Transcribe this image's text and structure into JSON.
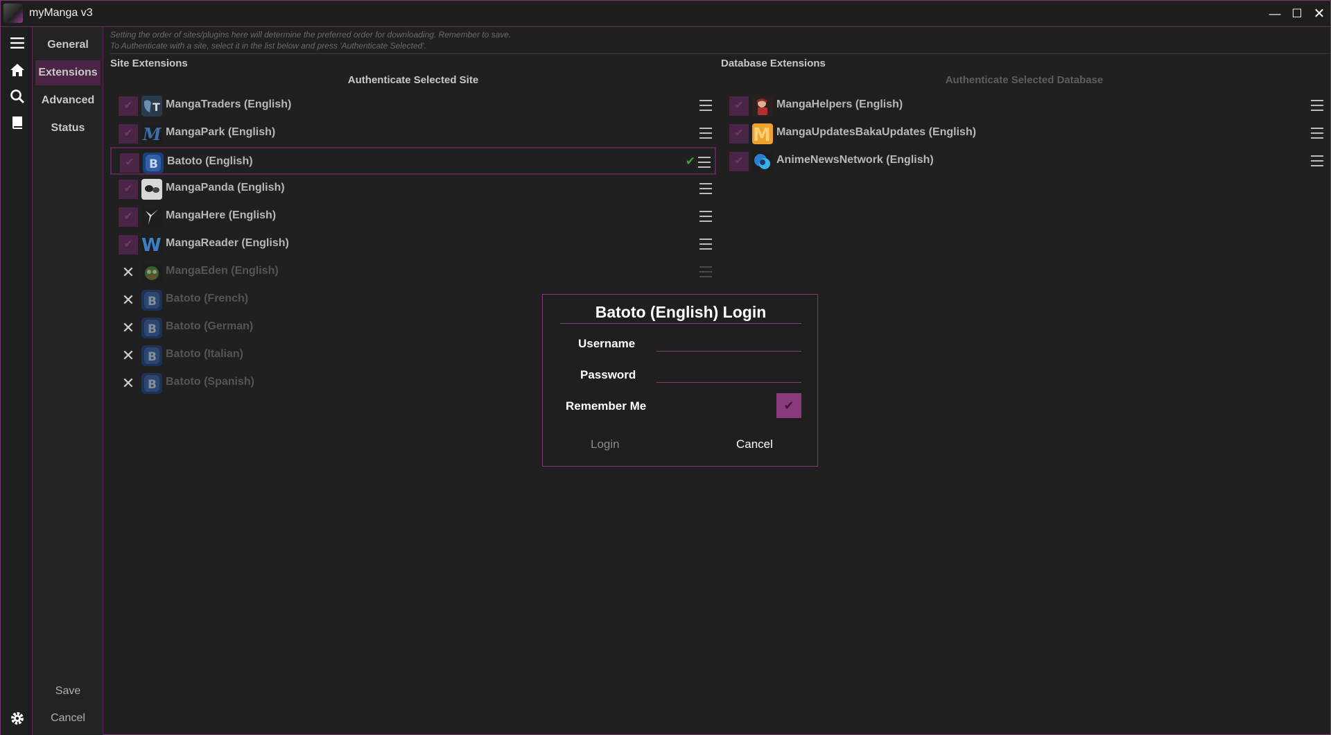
{
  "window": {
    "title": "myManga v3"
  },
  "nav": {
    "items": [
      "General",
      "Extensions",
      "Advanced",
      "Status"
    ],
    "active": "Extensions",
    "save": "Save",
    "cancel": "Cancel"
  },
  "hint": {
    "line1": "Setting the order of sites/plugins here will determine the preferred order for downloading. Remember to save.",
    "line2": "To Authenticate with a site, select it in the list below and press 'Authenticate Selected'."
  },
  "site_extensions": {
    "title": "Site Extensions",
    "authenticate_label": "Authenticate Selected Site",
    "items": [
      {
        "label": "MangaTraders (English)",
        "enabled": true,
        "icon": "mangatraders-icon"
      },
      {
        "label": "MangaPark (English)",
        "enabled": true,
        "icon": "mangapark-icon"
      },
      {
        "label": "Batoto (English)",
        "enabled": true,
        "icon": "batoto-icon",
        "selected": true,
        "authenticated": true
      },
      {
        "label": "MangaPanda (English)",
        "enabled": true,
        "icon": "mangapanda-icon"
      },
      {
        "label": "MangaHere (English)",
        "enabled": true,
        "icon": "mangahere-icon"
      },
      {
        "label": "MangaReader (English)",
        "enabled": true,
        "icon": "mangareader-icon"
      },
      {
        "label": "MangaEden (English)",
        "enabled": false,
        "icon": "mangaeden-icon"
      },
      {
        "label": "Batoto (French)",
        "enabled": false,
        "icon": "batoto-icon"
      },
      {
        "label": "Batoto (German)",
        "enabled": false,
        "icon": "batoto-icon"
      },
      {
        "label": "Batoto (Italian)",
        "enabled": false,
        "icon": "batoto-icon"
      },
      {
        "label": "Batoto (Spanish)",
        "enabled": false,
        "icon": "batoto-icon"
      }
    ]
  },
  "database_extensions": {
    "title": "Database Extensions",
    "authenticate_label": "Authenticate Selected Database",
    "items": [
      {
        "label": "MangaHelpers (English)",
        "enabled": true,
        "icon": "mangahelpers-icon"
      },
      {
        "label": "MangaUpdatesBakaUpdates (English)",
        "enabled": true,
        "icon": "mangaupdates-icon"
      },
      {
        "label": "AnimeNewsNetwork (English)",
        "enabled": true,
        "icon": "animenewsnetwork-icon"
      }
    ]
  },
  "login_dialog": {
    "title": "Batoto (English) Login",
    "username_label": "Username",
    "username_value": "",
    "password_label": "Password",
    "password_value": "",
    "remember_label": "Remember Me",
    "remember_checked": true,
    "login_button": "Login",
    "cancel_button": "Cancel"
  },
  "colors": {
    "accent": "#8a3a7c",
    "accent_dark": "#4a2545",
    "background": "#202020",
    "ok_green": "#3aa33a"
  }
}
